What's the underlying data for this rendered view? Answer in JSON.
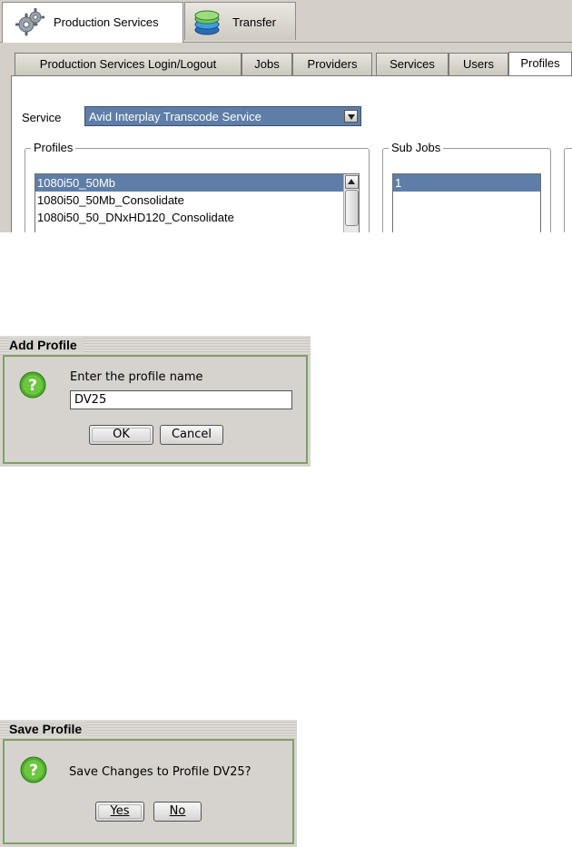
{
  "app": {
    "tabs": [
      {
        "label": "Production Services",
        "icon": "gear-cluster-icon",
        "active": true
      },
      {
        "label": "Transfer",
        "icon": "transfer-stack-icon",
        "active": false
      }
    ],
    "subtabs": [
      {
        "label": "Production Services Login/Logout",
        "active": false
      },
      {
        "label": "Jobs",
        "active": false
      },
      {
        "label": "Providers",
        "active": false
      },
      {
        "label": "Services",
        "active": false
      },
      {
        "label": "Users",
        "active": false
      },
      {
        "label": "Profiles",
        "active": true
      }
    ],
    "service": {
      "label": "Service",
      "value": "Avid Interplay Transcode Service"
    },
    "profiles_group": {
      "legend": "Profiles",
      "items": [
        "1080i50_50Mb",
        "1080i50_50Mb_Consolidate",
        "1080i50_50_DNxHD120_Consolidate"
      ],
      "selected_index": 0
    },
    "subjobs_group": {
      "legend": "Sub Jobs",
      "items": [
        "1"
      ],
      "selected_index": 0
    }
  },
  "add_profile_dialog": {
    "title": "Add Profile",
    "icon": "question-icon",
    "prompt": "Enter the profile name",
    "input_value": "DV25",
    "ok_label": "OK",
    "cancel_label": "Cancel"
  },
  "save_profile_dialog": {
    "title": "Save Profile",
    "icon": "question-icon",
    "message": "Save Changes to Profile DV25?",
    "yes_label": "Yes",
    "no_label": "No"
  },
  "colors": {
    "selection": "#5f7ea7",
    "dialog_border": "#7ea06b",
    "question_icon": "#4fae2b"
  }
}
